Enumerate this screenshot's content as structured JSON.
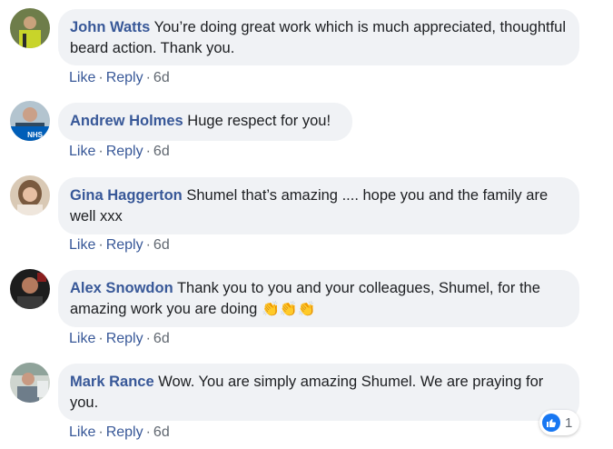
{
  "comments": [
    {
      "author": "John Watts",
      "text": "You’re doing great work which is much appreciated, thoughtful beard action. Thank you.",
      "emoji": "",
      "avatar": "avatar-john"
    },
    {
      "author": "Andrew Holmes",
      "text": "Huge respect for you!",
      "emoji": "",
      "avatar": "avatar-andrew",
      "badge": "NHS"
    },
    {
      "author": "Gina Haggerton",
      "text": "Shumel that’s amazing .... hope you and the family are well xxx",
      "emoji": "",
      "avatar": "avatar-gina"
    },
    {
      "author": "Alex Snowdon",
      "text": "Thank you to you and your colleagues, Shumel, for the amazing work you are doing",
      "emoji": "👏👏👏",
      "avatar": "avatar-alex"
    },
    {
      "author": "Mark Rance",
      "text": "Wow. You are simply amazing Shumel. We are praying for you.",
      "emoji": "",
      "avatar": "avatar-mark"
    }
  ],
  "actions": {
    "like": "Like",
    "reply": "Reply",
    "sep": "·",
    "time": "6d"
  },
  "reaction": {
    "icon": "thumbs-up-icon",
    "count": "1"
  },
  "colors": {
    "link": "#385898",
    "bubble": "#f0f2f5",
    "like": "#1877f2",
    "meta": "#606770"
  }
}
